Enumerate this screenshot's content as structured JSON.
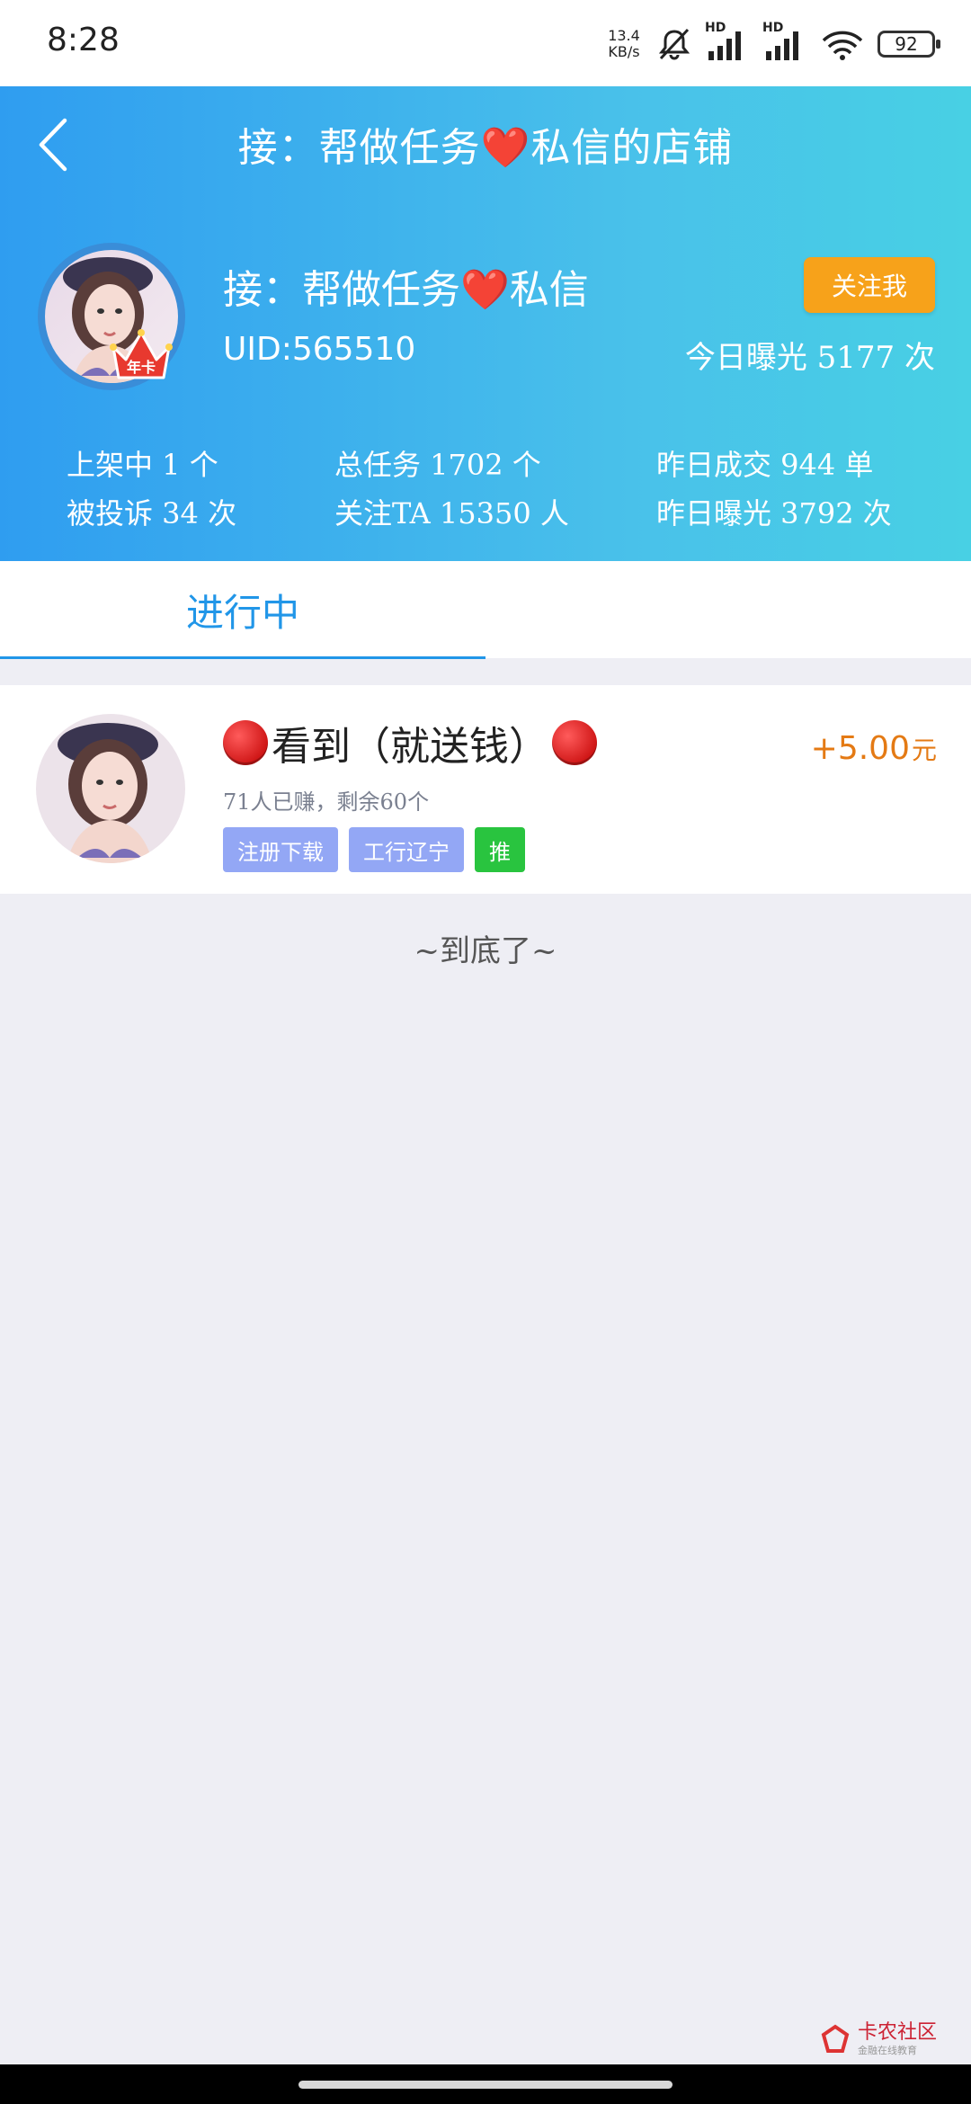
{
  "status_bar": {
    "time": "8:28",
    "net_speed_value": "13.4",
    "net_speed_unit": "KB/s",
    "hd1": "HD",
    "hd2": "HD",
    "battery": "92"
  },
  "header": {
    "title": "接：帮做任务❤️私信的店铺",
    "shop_name": "接：帮做任务❤️私信",
    "uid": "UID:565510",
    "follow_label": "关注我",
    "exposure_today": "今日曝光 5177 次",
    "badge_label": "年卡",
    "stats": {
      "listed": "上架中 1 个",
      "total_tasks": "总任务 1702 个",
      "yesterday_deals": "昨日成交 944 单",
      "complaints": "被投诉 34 次",
      "followers": "关注TA 15350 人",
      "yesterday_exposure": "昨日曝光 3792 次"
    }
  },
  "tabs": [
    {
      "label": "进行中",
      "active": true
    }
  ],
  "task": {
    "title": "看到（就送钱）",
    "subtitle": "71人已赚，剩余60个",
    "tags": [
      "注册下载",
      "工行辽宁",
      "推"
    ],
    "reward_amount": "+5.00",
    "reward_unit": "元"
  },
  "end_text": "~到底了~",
  "watermark": {
    "main": "卡农社区",
    "sub": "金融在线教育"
  },
  "colors": {
    "header_gradient_start": "#2f9df0",
    "header_gradient_end": "#48d0e4",
    "follow_button": "#f7a21a",
    "tab_active": "#2196e8",
    "reward": "#e47a14",
    "tag_blue": "#93a7f5",
    "tag_green": "#29c43f"
  },
  "icons": [
    "back-arrow-icon",
    "mute-bell-icon",
    "signal-icon",
    "wifi-icon",
    "battery-icon",
    "crown-badge-icon",
    "red-dot-icon"
  ]
}
